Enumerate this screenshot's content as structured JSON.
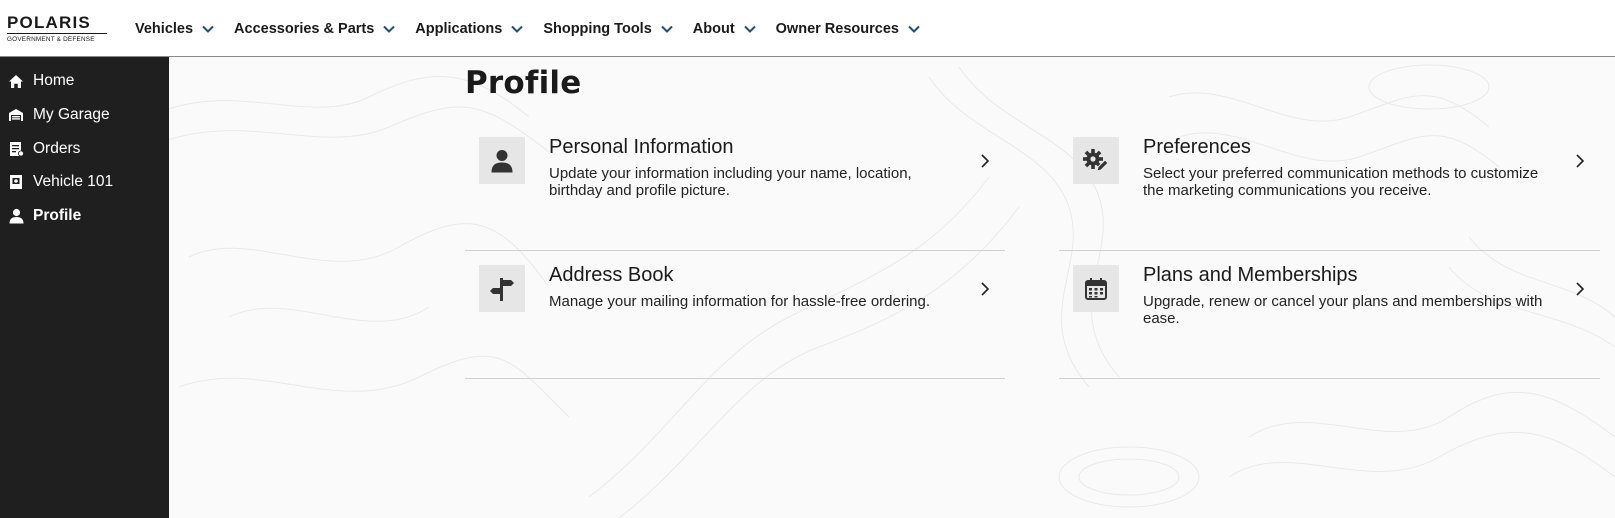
{
  "brand": {
    "name": "POLARIS",
    "subtitle": "GOVERNMENT & DEFENSE"
  },
  "nav": {
    "items": [
      {
        "label": "Vehicles"
      },
      {
        "label": "Accessories & Parts"
      },
      {
        "label": "Applications"
      },
      {
        "label": "Shopping Tools"
      },
      {
        "label": "About"
      },
      {
        "label": "Owner Resources"
      }
    ]
  },
  "sidebar": {
    "items": [
      {
        "label": "Home",
        "icon": "home-icon"
      },
      {
        "label": "My Garage",
        "icon": "garage-icon"
      },
      {
        "label": "Orders",
        "icon": "orders-icon"
      },
      {
        "label": "Vehicle 101",
        "icon": "book-icon"
      },
      {
        "label": "Profile",
        "icon": "user-icon",
        "active": true
      }
    ]
  },
  "page": {
    "title": "Profile"
  },
  "cards": {
    "personal": {
      "title": "Personal Information",
      "description": "Update your information including your name, location, birthday and profile picture.",
      "icon": "user-icon"
    },
    "preferences": {
      "title": "Preferences",
      "description": "Select your preferred communication methods to customize the marketing communications you receive.",
      "icon": "gear-edit-icon"
    },
    "address": {
      "title": "Address Book",
      "description": "Manage your mailing information for hassle-free ordering.",
      "icon": "signpost-icon"
    },
    "plans": {
      "title": "Plans and Memberships",
      "description": "Upgrade, renew or cancel your plans and memberships with ease.",
      "icon": "calendar-icon"
    }
  },
  "colors": {
    "sidebar_bg": "#1f1f1f",
    "nav_chevron": "#1e4f7a",
    "icon_box": "#e6e6e6",
    "background": "#fafafa"
  }
}
